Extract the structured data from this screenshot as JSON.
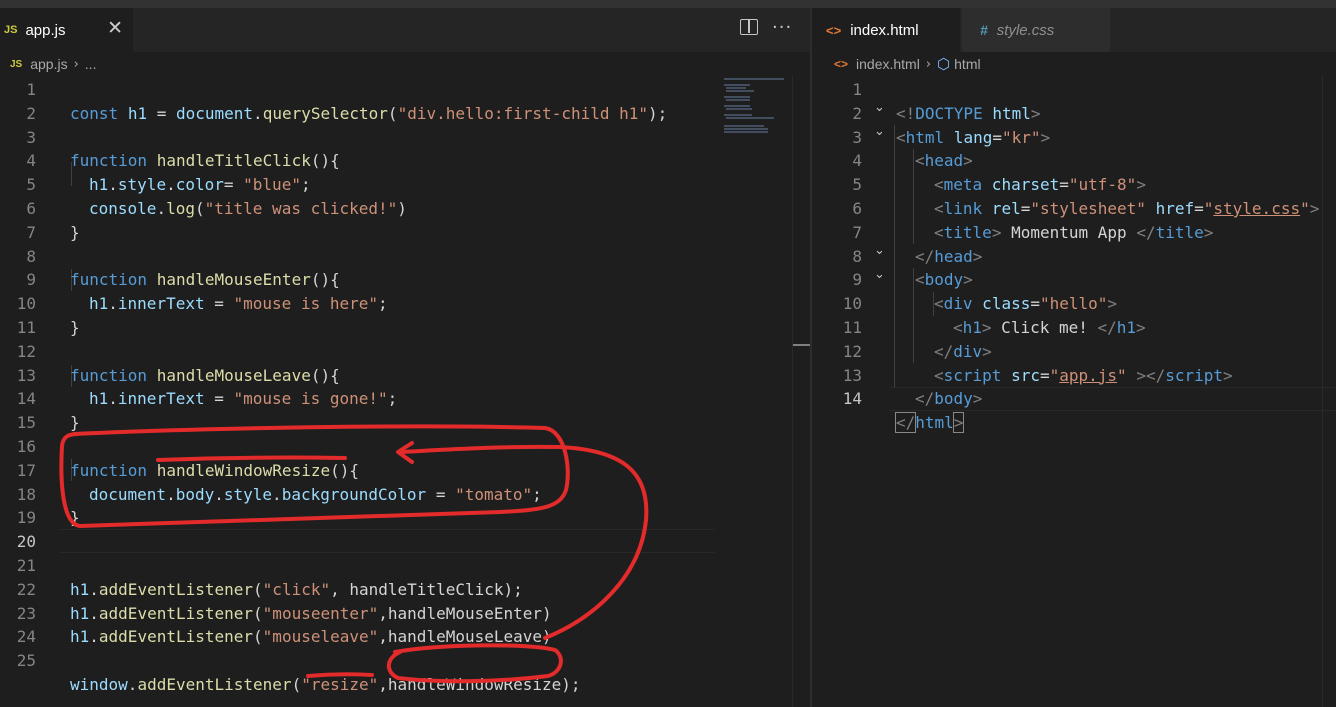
{
  "left_editor": {
    "tab": {
      "badge": "JS",
      "label": "app.js",
      "close": "✕"
    },
    "toolbar": {
      "more": "···"
    },
    "breadcrumb": {
      "badge": "JS",
      "file": "app.js",
      "sep": "›",
      "rest": "..."
    },
    "line_numbers": [
      "1",
      "2",
      "3",
      "4",
      "5",
      "6",
      "7",
      "8",
      "9",
      "10",
      "11",
      "12",
      "13",
      "14",
      "15",
      "16",
      "17",
      "18",
      "19",
      "20",
      "21",
      "22",
      "23",
      "24",
      "25"
    ],
    "code": {
      "l1": {
        "kw": "const",
        "v": "h1",
        "eq": " = ",
        "obj": "document",
        "dot": ".",
        "m": "querySelector",
        "p1": "(",
        "s": "\"div.hello:first-child h1\"",
        "p2": ");"
      },
      "l3": {
        "kw": "function",
        "fn": "handleTitleClick",
        "p": "(){"
      },
      "l4": {
        "v1": "h1",
        "d1": ".",
        "v2": "style",
        "d2": ".",
        "v3": "color",
        "eq": "= ",
        "s": "\"blue\"",
        "e": ";"
      },
      "l5": {
        "v": "console",
        "d": ".",
        "m": "log",
        "p1": "(",
        "s": "\"title was clicked!\"",
        "p2": ")"
      },
      "l6": {
        "c": "}"
      },
      "l8": {
        "kw": "function",
        "fn": "handleMouseEnter",
        "p": "(){"
      },
      "l9": {
        "v1": "h1",
        "d": ".",
        "v2": "innerText",
        "eq": " = ",
        "s": "\"mouse is here\"",
        "e": ";"
      },
      "l10": {
        "c": "}"
      },
      "l12": {
        "kw": "function",
        "fn": "handleMouseLeave",
        "p": "(){"
      },
      "l13": {
        "v1": "h1",
        "d": ".",
        "v2": "innerText",
        "eq": " = ",
        "s": "\"mouse is gone!\"",
        "e": ";"
      },
      "l14": {
        "c": "}"
      },
      "l16": {
        "kw": "function",
        "fn": "handleWindowResize",
        "p": "(){"
      },
      "l17": {
        "v1": "document",
        "d1": ".",
        "v2": "body",
        "d2": ".",
        "v3": "style",
        "d3": ".",
        "v4": "backgroundColor",
        "eq": " = ",
        "s": "\"tomato\"",
        "e": ";"
      },
      "l18": {
        "c": "}"
      },
      "l21": {
        "v": "h1",
        "d": ".",
        "m": "addEventListener",
        "p1": "(",
        "s": "\"click\"",
        "c": ", ",
        "a": "handleTitleClick",
        "p2": ");"
      },
      "l22": {
        "v": "h1",
        "d": ".",
        "m": "addEventListener",
        "p1": "(",
        "s": "\"mouseenter\"",
        "c": ",",
        "a": "handleMouseEnter",
        "p2": ")"
      },
      "l23": {
        "v": "h1",
        "d": ".",
        "m": "addEventListener",
        "p1": "(",
        "s": "\"mouseleave\"",
        "c": ",",
        "a": "handleMouseLeave",
        "p2": ")"
      },
      "l25": {
        "v": "window",
        "d": ".",
        "m": "addEventListener",
        "p1": "(",
        "s": "\"resize\"",
        "c": ",",
        "a": "handleWindowResize",
        "p2": ");"
      }
    }
  },
  "right_editor": {
    "tabs": [
      {
        "badge": "<>",
        "label": "index.html"
      },
      {
        "badge": "#",
        "label": "style.css"
      }
    ],
    "breadcrumb": {
      "badge": "<>",
      "file": "index.html",
      "sep": "›",
      "node": "html"
    },
    "line_numbers": [
      "1",
      "2",
      "3",
      "4",
      "5",
      "6",
      "7",
      "8",
      "9",
      "10",
      "11",
      "12",
      "13",
      "14"
    ],
    "fold_arrow": "⌄",
    "code": {
      "l1": {
        "o": "<!",
        "t": "DOCTYPE",
        "a": " html",
        "c": ">"
      },
      "l2": {
        "o": "<",
        "t": "html",
        "a": " lang",
        "eq": "=",
        "s": "\"kr\"",
        "c": ">"
      },
      "l3": {
        "o": "<",
        "t": "head",
        "c": ">"
      },
      "l4": {
        "o": "<",
        "t": "meta",
        "a": " charset",
        "eq": "=",
        "s": "\"utf-8\"",
        "c": ">"
      },
      "l5": {
        "o": "<",
        "t": "link",
        "a1": " rel",
        "eq1": "=",
        "s1": "\"stylesheet\"",
        "a2": " href",
        "eq2": "=",
        "q1": "\"",
        "s2": "style.css",
        "q2": "\"",
        "c": ">"
      },
      "l6": {
        "o": "<",
        "t": "title",
        "c": ">",
        "txt": " Momentum App ",
        "o2": "</",
        "t2": "title",
        "c2": ">"
      },
      "l7": {
        "o": "</",
        "t": "head",
        "c": ">"
      },
      "l8": {
        "o": "<",
        "t": "body",
        "c": ">"
      },
      "l9": {
        "o": "<",
        "t": "div",
        "a": " class",
        "eq": "=",
        "s": "\"hello\"",
        "c": ">"
      },
      "l10": {
        "o": "<",
        "t": "h1",
        "c": ">",
        "txt": " Click me! ",
        "o2": "</",
        "t2": "h1",
        "c2": ">"
      },
      "l11": {
        "o": "</",
        "t": "div",
        "c": ">"
      },
      "l12": {
        "o": "<",
        "t": "script",
        "a": " src",
        "eq": "=",
        "q1": "\"",
        "s": "app.js",
        "q2": "\"",
        "sp": " ",
        "c": ">",
        "o2": "</",
        "t2": "script",
        "c2": ">"
      },
      "l13": {
        "o": "</",
        "t": "body",
        "c": ">"
      },
      "l14": {
        "o": "</",
        "t": "html",
        "c": ">"
      }
    }
  },
  "colors": {
    "annotation": "#e32b2b",
    "keyword": "#569cd6",
    "function": "#dcdcaa",
    "variable": "#9cdcfe",
    "string": "#ce9178"
  }
}
